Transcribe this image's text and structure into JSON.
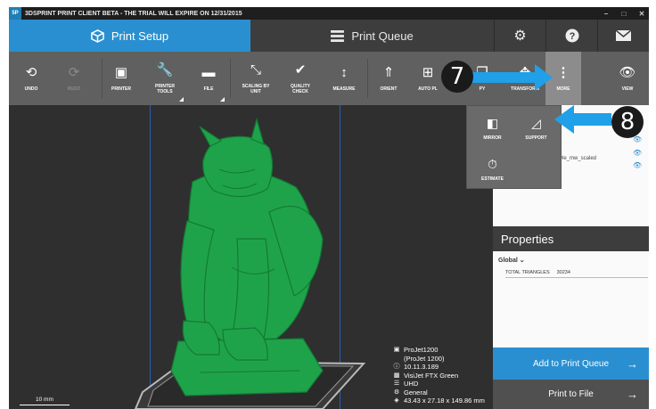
{
  "window": {
    "title": "3DSPRINT PRINT CLIENT BETA - THE TRIAL WILL EXPIRE ON 12/31/2015",
    "logo": "5P"
  },
  "tabs": {
    "print_setup": "Print Setup",
    "print_queue": "Print Queue"
  },
  "toolbar": {
    "undo": "UNDO",
    "redo": "REDO",
    "printer": "PRINTER",
    "printer_tools": "PRINTER\nTOOLS",
    "file": "FILE",
    "scaling": "SCALING BY\nUNIT",
    "quality": "QUALITY\nCHECK",
    "measure": "MEASURE",
    "orient": "ORIENT",
    "auto_place": "AUTO PL",
    "copy": "PY",
    "transform": "TRANSFORM",
    "more": "MORE",
    "view": "VIEW"
  },
  "more_menu": {
    "mirror": "MIRROR",
    "support": "SUPPORT",
    "estimate": "ESTIMATE"
  },
  "callouts": {
    "step7": "7",
    "step8": "8"
  },
  "scene": {
    "item": "yle_mw_scaled"
  },
  "properties": {
    "title": "Properties",
    "global": "Global",
    "triangles_label": "TOTAL TRIANGLES",
    "triangles_value": "30234"
  },
  "printer_info": {
    "name": "ProJet1200",
    "model": "(ProJet 1200)",
    "ip": "10.11.3.189",
    "material": "VisiJet FTX Green",
    "mode": "UHD",
    "profile": "General",
    "dims": "43.43 x 27.18 x 149.86 mm"
  },
  "scale": {
    "label": "10 mm"
  },
  "buttons": {
    "add_queue": "Add to Print Queue",
    "print_file": "Print to File"
  },
  "colors": {
    "accent": "#2a8fd0",
    "model": "#1fa34a",
    "arrow": "#1fa0e8"
  },
  "icons": [
    "undo-icon",
    "redo-icon",
    "printer-icon",
    "wrench-icon",
    "file-icon",
    "scaling-icon",
    "quality-check-icon",
    "measure-icon",
    "orient-icon",
    "auto-place-icon",
    "copy-icon",
    "transform-icon",
    "more-icon",
    "view-icon",
    "mirror-icon",
    "support-icon",
    "estimate-icon",
    "gear-icon",
    "help-icon",
    "mail-icon",
    "cube-icon",
    "list-icon",
    "eye-icon"
  ]
}
